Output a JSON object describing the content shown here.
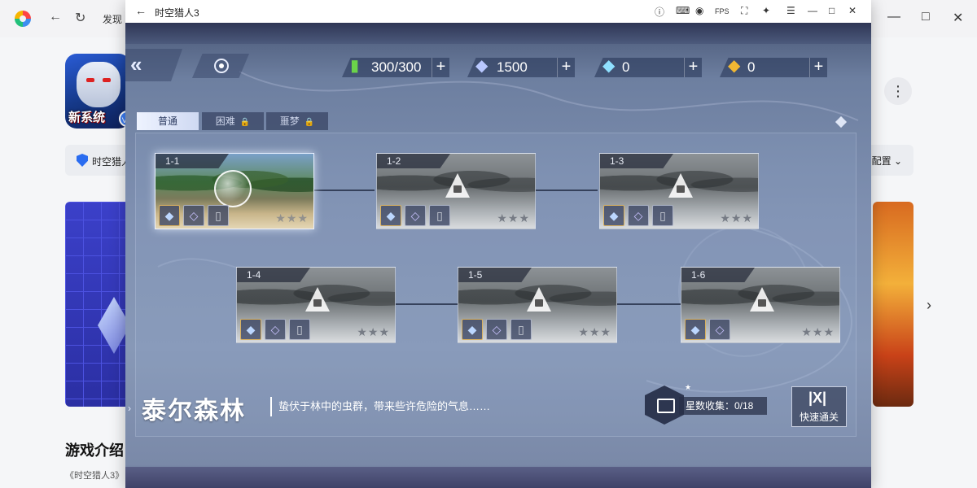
{
  "store": {
    "nav_tab": "发现",
    "app_icon_text": "新系统",
    "app_badge": "VR",
    "info_name": "时空猎人",
    "info_config": "配置",
    "desc_title": "游戏介绍",
    "desc_text": "《时空猎人3》"
  },
  "window": {
    "title": "时空猎人3",
    "fps_label": "FPS"
  },
  "game": {
    "resources": [
      {
        "icon": "stamina-vial-icon",
        "value": "300/300",
        "color": "#6bd34a"
      },
      {
        "icon": "diamond-icon",
        "value": "1500",
        "color": "#b9c8ff"
      },
      {
        "icon": "crystal-icon",
        "value": "0",
        "color": "#8fe0ff"
      },
      {
        "icon": "gold-gem-icon",
        "value": "0",
        "color": "#f1b833"
      }
    ],
    "mode_tabs": [
      {
        "label": "普通",
        "active": true
      },
      {
        "label": "困难",
        "locked": true
      },
      {
        "label": "噩梦",
        "locked": true
      }
    ],
    "stages": [
      {
        "id": "1-1",
        "locked": false
      },
      {
        "id": "1-2",
        "locked": true
      },
      {
        "id": "1-3",
        "locked": true
      },
      {
        "id": "1-4",
        "locked": true
      },
      {
        "id": "1-5",
        "locked": true
      },
      {
        "id": "1-6",
        "locked": true
      }
    ],
    "stars_symbol": "★★★",
    "area_name": "泰尔森林",
    "area_desc": "蛰伏于林中的虫群，带来些许危险的气息……",
    "star_collect": "星数收集：0/18",
    "sweep_label": "快速通关",
    "colors": {
      "accent": "#eaf0ff",
      "panel": "#8798b7"
    }
  }
}
